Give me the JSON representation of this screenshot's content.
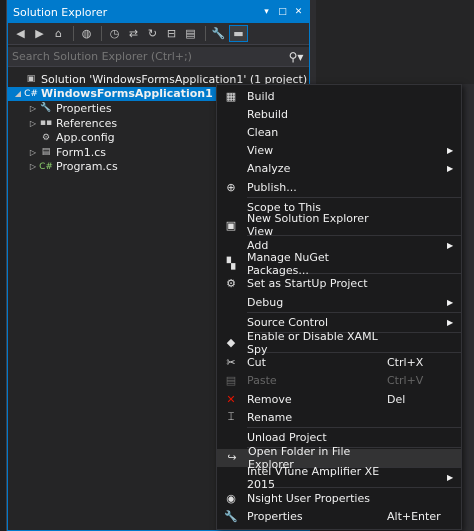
{
  "panel": {
    "title": "Solution Explorer",
    "title_buttons": [
      "▾",
      "□",
      "✕"
    ],
    "search_placeholder": "Search Solution Explorer (Ctrl+;)"
  },
  "tree": [
    {
      "label": "Solution 'WindowsFormsApplication1' (1 project)",
      "indent": 0,
      "arrow": "",
      "icon": "solution-icon",
      "glyph": "▣",
      "color": "#c8c8c8"
    },
    {
      "label": "WindowsFormsApplication1",
      "indent": 0,
      "arrow": "◢",
      "icon": "csharp-project-icon",
      "glyph": "C#",
      "color": "#ffffff",
      "selected": true
    },
    {
      "label": "Properties",
      "indent": 1,
      "arrow": "▷",
      "icon": "wrench-icon",
      "glyph": "🔧",
      "color": "#c8c8c8"
    },
    {
      "label": "References",
      "indent": 1,
      "arrow": "▷",
      "icon": "references-icon",
      "glyph": "▪▪",
      "color": "#c8c8c8"
    },
    {
      "label": "App.config",
      "indent": 1,
      "arrow": "",
      "icon": "config-file-icon",
      "glyph": "⚙",
      "color": "#c8c8c8"
    },
    {
      "label": "Form1.cs",
      "indent": 1,
      "arrow": "▷",
      "icon": "form-icon",
      "glyph": "▤",
      "color": "#c8c8c8"
    },
    {
      "label": "Program.cs",
      "indent": 1,
      "arrow": "▷",
      "icon": "csharp-file-icon",
      "glyph": "C#",
      "color": "#8dd16e"
    }
  ],
  "menu": [
    {
      "type": "item",
      "label": "Build",
      "icon": "build-icon",
      "glyph": "▦"
    },
    {
      "type": "item",
      "label": "Rebuild",
      "icon": "",
      "glyph": ""
    },
    {
      "type": "item",
      "label": "Clean",
      "icon": "",
      "glyph": ""
    },
    {
      "type": "item",
      "label": "View",
      "icon": "",
      "glyph": "",
      "submenu": true
    },
    {
      "type": "item",
      "label": "Analyze",
      "icon": "",
      "glyph": "",
      "submenu": true
    },
    {
      "type": "item",
      "label": "Publish...",
      "icon": "publish-icon",
      "glyph": "⊕"
    },
    {
      "type": "sep"
    },
    {
      "type": "item",
      "label": "Scope to This",
      "icon": "",
      "glyph": ""
    },
    {
      "type": "item",
      "label": "New Solution Explorer View",
      "icon": "new-view-icon",
      "glyph": "▣"
    },
    {
      "type": "sep"
    },
    {
      "type": "item",
      "label": "Add",
      "icon": "",
      "glyph": "",
      "submenu": true
    },
    {
      "type": "item",
      "label": "Manage NuGet Packages...",
      "icon": "nuget-icon",
      "glyph": "▚"
    },
    {
      "type": "sep"
    },
    {
      "type": "item",
      "label": "Set as StartUp Project",
      "icon": "gear-icon",
      "glyph": "⚙"
    },
    {
      "type": "item",
      "label": "Debug",
      "icon": "",
      "glyph": "",
      "submenu": true
    },
    {
      "type": "sep"
    },
    {
      "type": "item",
      "label": "Source Control",
      "icon": "",
      "glyph": "",
      "submenu": true
    },
    {
      "type": "sep"
    },
    {
      "type": "item",
      "label": "Enable or Disable XAML Spy",
      "icon": "xaml-spy-icon",
      "glyph": "◆"
    },
    {
      "type": "sep"
    },
    {
      "type": "item",
      "label": "Cut",
      "icon": "scissors-icon",
      "glyph": "✂",
      "shortcut": "Ctrl+X"
    },
    {
      "type": "item",
      "label": "Paste",
      "icon": "paste-icon",
      "glyph": "▤",
      "shortcut": "Ctrl+V",
      "disabled": true
    },
    {
      "type": "item",
      "label": "Remove",
      "icon": "remove-icon",
      "glyph": "✕",
      "shortcut": "Del",
      "red": true
    },
    {
      "type": "item",
      "label": "Rename",
      "icon": "rename-icon",
      "glyph": "⌶"
    },
    {
      "type": "sep"
    },
    {
      "type": "item",
      "label": "Unload Project",
      "icon": "",
      "glyph": ""
    },
    {
      "type": "sep"
    },
    {
      "type": "item",
      "label": "Open Folder in File Explorer",
      "icon": "open-folder-icon",
      "glyph": "↪",
      "highlighted": true
    },
    {
      "type": "sep"
    },
    {
      "type": "item",
      "label": "Intel VTune Amplifier XE 2015",
      "icon": "",
      "glyph": "",
      "submenu": true
    },
    {
      "type": "sep"
    },
    {
      "type": "item",
      "label": "Nsight User Properties",
      "icon": "nsight-icon",
      "glyph": "◉"
    },
    {
      "type": "item",
      "label": "Properties",
      "icon": "wrench-icon",
      "glyph": "🔧",
      "shortcut": "Alt+Enter"
    }
  ]
}
